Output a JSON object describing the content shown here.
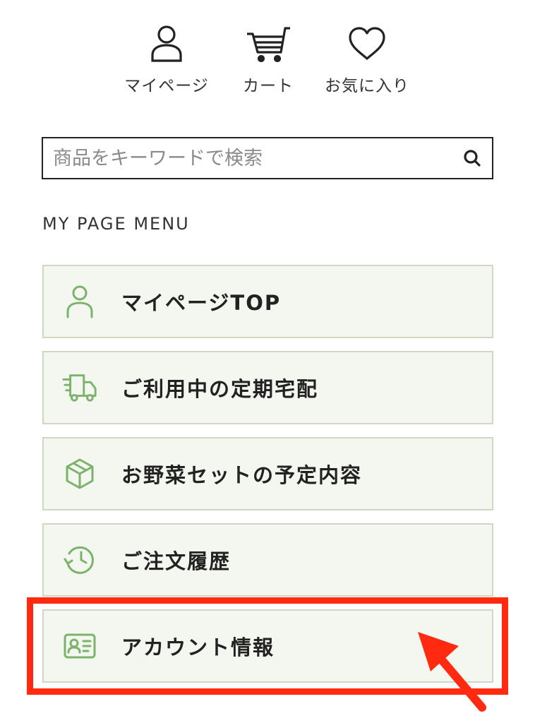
{
  "top_nav": {
    "mypage_label": "マイページ",
    "cart_label": "カート",
    "favorites_label": "お気に入り"
  },
  "search": {
    "placeholder": "商品をキーワードで検索"
  },
  "menu": {
    "title": "MY PAGE MENU",
    "items": [
      {
        "label": "マイページTOP",
        "icon": "user-icon"
      },
      {
        "label": "ご利用中の定期宅配",
        "icon": "delivery-truck-icon"
      },
      {
        "label": "お野菜セットの予定内容",
        "icon": "box-icon"
      },
      {
        "label": "ご注文履歴",
        "icon": "history-icon"
      },
      {
        "label": "アカウント情報",
        "icon": "id-card-icon"
      }
    ]
  },
  "colors": {
    "accent_green": "#7bb36a",
    "menu_bg": "#f4f6f0",
    "menu_border": "#cfd8c4",
    "highlight_red": "#ff2a10"
  }
}
